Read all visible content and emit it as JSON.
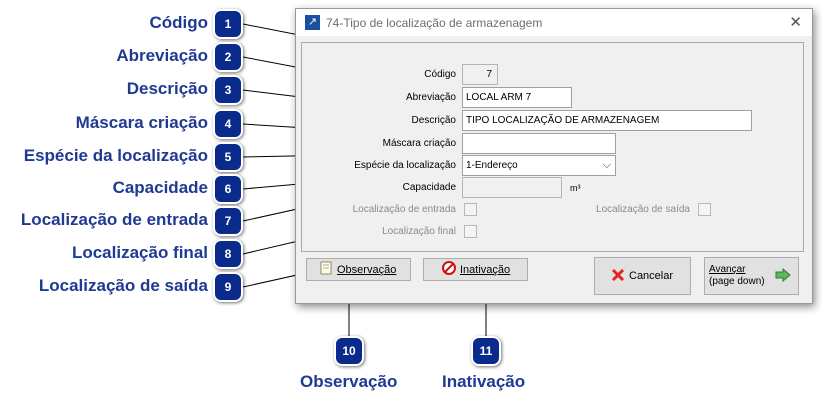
{
  "callouts": [
    {
      "n": "1",
      "label": "Código"
    },
    {
      "n": "2",
      "label": "Abreviação"
    },
    {
      "n": "3",
      "label": "Descrição"
    },
    {
      "n": "4",
      "label": "Máscara criação"
    },
    {
      "n": "5",
      "label": "Espécie da localização"
    },
    {
      "n": "6",
      "label": "Capacidade"
    },
    {
      "n": "7",
      "label": "Localização de entrada"
    },
    {
      "n": "8",
      "label": "Localização final"
    },
    {
      "n": "9",
      "label": "Localização de saída"
    },
    {
      "n": "10",
      "label": "Observação"
    },
    {
      "n": "11",
      "label": "Inativação"
    }
  ],
  "window": {
    "title": "74-Tipo de localização de armazenagem",
    "close_glyph": "✕",
    "icon_glyph": "↗"
  },
  "form": {
    "codigo": {
      "label": "Código",
      "value": "7"
    },
    "abreviacao": {
      "label": "Abreviação",
      "value": "LOCAL ARM 7"
    },
    "descricao": {
      "label": "Descrição",
      "value": "TIPO LOCALIZAÇÃO DE ARMAZENAGEM"
    },
    "mascara": {
      "label": "Máscara criação",
      "value": ""
    },
    "especie": {
      "label": "Espécie da localização",
      "value": "1-Endereço"
    },
    "capacidade": {
      "label": "Capacidade",
      "value": "",
      "unit": "m³"
    },
    "loc_entrada": {
      "label": "Localização de entrada",
      "checked": false
    },
    "loc_final": {
      "label": "Localização final",
      "checked": false
    },
    "loc_saida": {
      "label": "Localização de saída",
      "checked": false
    }
  },
  "buttons": {
    "observacao": {
      "label": "Observação"
    },
    "inativacao": {
      "label": "Inativação"
    },
    "cancelar": {
      "label": "Cancelar"
    },
    "avancar_line1": "Avançar",
    "avancar_line2": "(page down)"
  },
  "colors": {
    "callout_text": "#1f3a93",
    "badge": "#0a2a8c",
    "window_bg": "#f0f0f0"
  }
}
